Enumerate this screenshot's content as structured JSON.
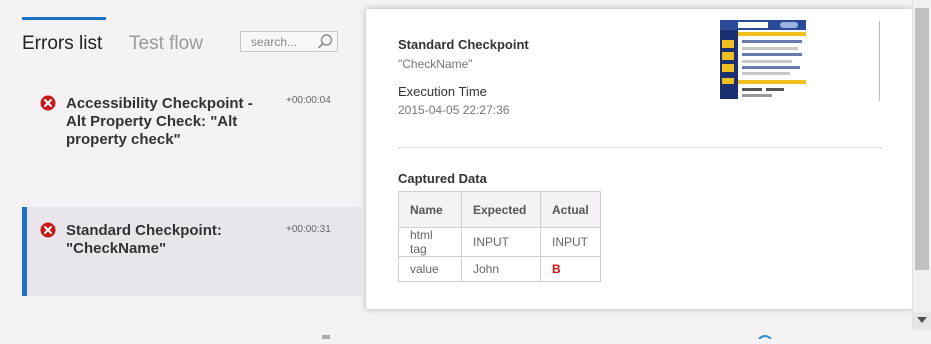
{
  "tabs": {
    "errors_list": "Errors list",
    "test_flow": "Test flow",
    "active": "errors_list"
  },
  "search": {
    "placeholder": "search..."
  },
  "errors": [
    {
      "title": "Accessibility Checkpoint - Alt Property Check: \"Alt property check\"",
      "time": "+00:00:04",
      "selected": false
    },
    {
      "title": "Standard Checkpoint: \"CheckName\"",
      "time": "+00:00:31",
      "selected": true
    }
  ],
  "detail": {
    "title": "Standard Checkpoint",
    "subtitle": "\"CheckName\"",
    "execution_time_label": "Execution Time",
    "execution_time_value": "2015-04-05 22:27:36",
    "captured_label": "Captured Data",
    "table": {
      "headers": [
        "Name",
        "Expected",
        "Actual"
      ],
      "rows": [
        [
          "html tag",
          "INPUT",
          "INPUT"
        ],
        [
          "value",
          "John",
          "B"
        ]
      ]
    }
  },
  "colors": {
    "accent": "#1a73c8",
    "error_red": "#c81818",
    "mismatch_red": "#d01010"
  },
  "icons": {
    "error": "error-x-icon",
    "search": "search-icon"
  }
}
